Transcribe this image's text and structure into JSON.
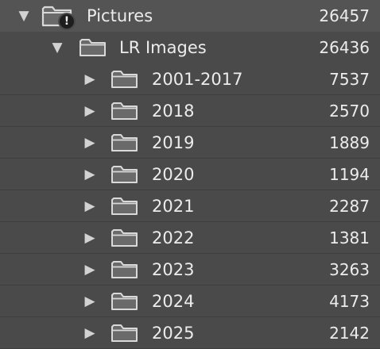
{
  "root": {
    "label": "Pictures",
    "count": "26457",
    "expanded": true,
    "badge": "!",
    "icon": "folder-warning-icon"
  },
  "collection": {
    "label": "LR Images",
    "count": "26436",
    "expanded": true,
    "icon": "folder-icon"
  },
  "children": [
    {
      "label": "2001-2017",
      "count": "7537"
    },
    {
      "label": "2018",
      "count": "2570"
    },
    {
      "label": "2019",
      "count": "1889"
    },
    {
      "label": "2020",
      "count": "1194"
    },
    {
      "label": "2021",
      "count": "2287"
    },
    {
      "label": "2022",
      "count": "1381"
    },
    {
      "label": "2023",
      "count": "3263"
    },
    {
      "label": "2024",
      "count": "4173"
    },
    {
      "label": "2025",
      "count": "2142"
    }
  ],
  "glyphs": {
    "expanded": "▼",
    "collapsed": "▶"
  },
  "colors": {
    "background": "#4a4a4a",
    "selected_row": "#545454",
    "text": "#ececec",
    "folder_stroke": "#d9d9d9"
  }
}
